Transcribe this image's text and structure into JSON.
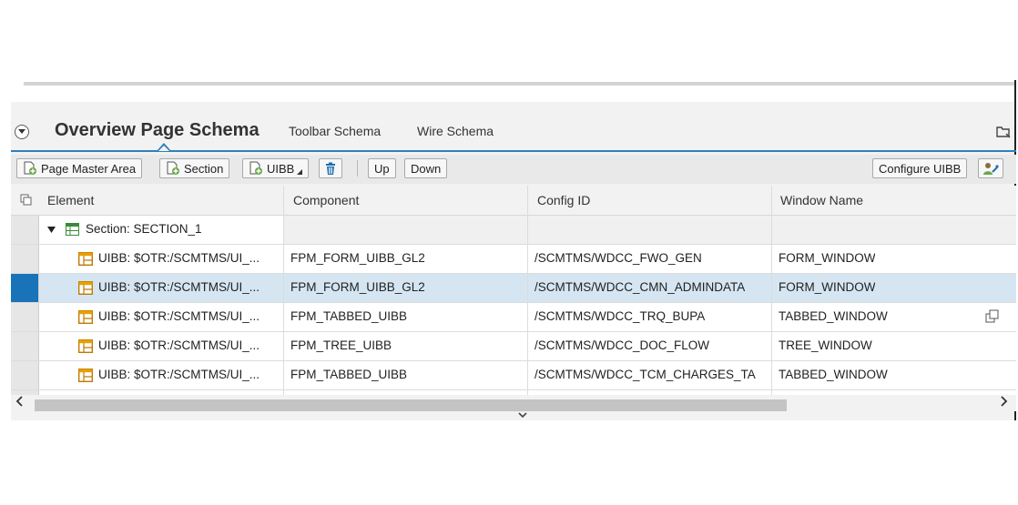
{
  "tabs": {
    "active": "Overview Page Schema",
    "others": [
      "Toolbar Schema",
      "Wire Schema"
    ]
  },
  "toolbar": {
    "page_master_area": "Page Master Area",
    "section": "Section",
    "uibb": "UIBB",
    "up": "Up",
    "down": "Down",
    "configure_uibb": "Configure UIBB"
  },
  "grid": {
    "columns": [
      "Element",
      "Component",
      "Config ID",
      "Window Name"
    ],
    "section_row": "Section: SECTION_1",
    "rows": [
      {
        "element": "UIBB: $OTR:/SCMTMS/UI_...",
        "component": "FPM_FORM_UIBB_GL2",
        "config_id": "/SCMTMS/WDCC_FWO_GEN",
        "window": "FORM_WINDOW"
      },
      {
        "element": "UIBB: $OTR:/SCMTMS/UI_...",
        "component": "FPM_FORM_UIBB_GL2",
        "config_id": "/SCMTMS/WDCC_CMN_ADMINDATA",
        "window": "FORM_WINDOW"
      },
      {
        "element": "UIBB: $OTR:/SCMTMS/UI_...",
        "component": "FPM_TABBED_UIBB",
        "config_id": "/SCMTMS/WDCC_TRQ_BUPA",
        "window": "TABBED_WINDOW"
      },
      {
        "element": "UIBB: $OTR:/SCMTMS/UI_...",
        "component": "FPM_TREE_UIBB",
        "config_id": "/SCMTMS/WDCC_DOC_FLOW",
        "window": "TREE_WINDOW"
      },
      {
        "element": "UIBB: $OTR:/SCMTMS/UI_...",
        "component": "FPM_TABBED_UIBB",
        "config_id": "/SCMTMS/WDCC_TCM_CHARGES_TA",
        "window": "TABBED_WINDOW"
      }
    ],
    "selected_row": 1
  },
  "colors": {
    "accent": "#2f7fbc",
    "selected_row": "#d5e6f2",
    "row_marker": "#1873b9"
  },
  "icons": [
    "collapse-icon",
    "folder-icon",
    "add-page-icon",
    "trash-icon",
    "personalize-icon",
    "section-icon",
    "uibb-icon",
    "popout-icon",
    "column-chooser-icon"
  ]
}
